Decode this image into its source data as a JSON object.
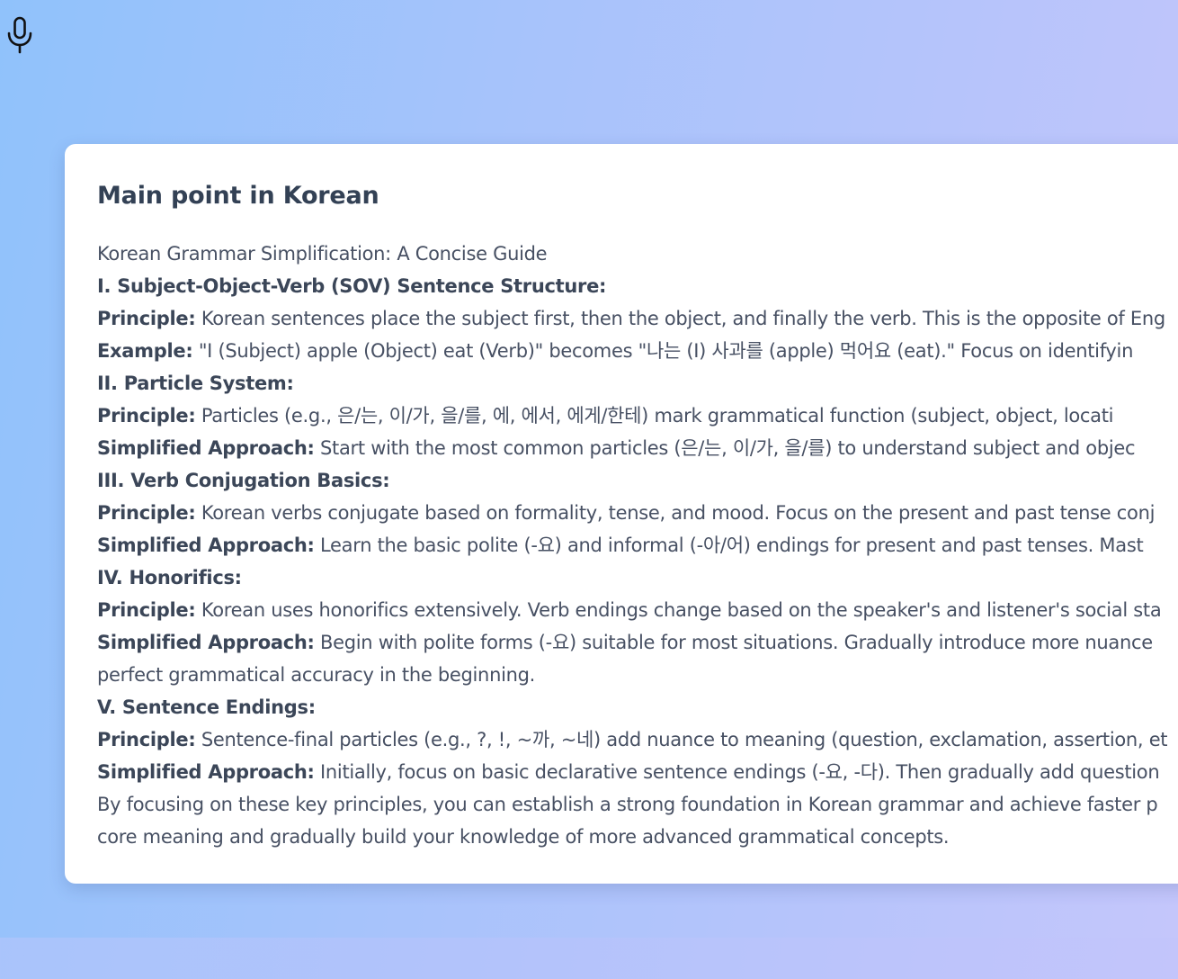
{
  "mic": {
    "icon": "microphone-icon"
  },
  "card": {
    "title": "Main point in Korean",
    "intro": "Korean Grammar Simplification: A Concise Guide",
    "sections": [
      {
        "heading": "I. Subject-Object-Verb (SOV) Sentence Structure:",
        "items": [
          {
            "label": "Principle:",
            "text": "Korean sentences place the subject first, then the object, and finally the verb. This is the opposite of Eng"
          },
          {
            "label": "Example:",
            "text": "\"I (Subject) apple (Object) eat (Verb)\" becomes \"나는 (I) 사과를 (apple) 먹어요 (eat).\" Focus on identifyin"
          }
        ]
      },
      {
        "heading": "II. Particle System:",
        "items": [
          {
            "label": "Principle:",
            "text": "Particles (e.g., 은/는, 이/가, 을/를, 에, 에서, 에게/한테) mark grammatical function (subject, object, locati"
          },
          {
            "label": "Simplified Approach:",
            "text": "Start with the most common particles (은/는, 이/가, 을/를) to understand subject and objec"
          }
        ]
      },
      {
        "heading": "III. Verb Conjugation Basics:",
        "items": [
          {
            "label": "Principle:",
            "text": "Korean verbs conjugate based on formality, tense, and mood. Focus on the present and past tense conj"
          },
          {
            "label": "Simplified Approach:",
            "text": "Learn the basic polite (-요) and informal (-아/어) endings for present and past tenses. Mast"
          }
        ]
      },
      {
        "heading": "IV. Honorifics:",
        "items": [
          {
            "label": "Principle:",
            "text": "Korean uses honorifics extensively. Verb endings change based on the speaker's and listener's social sta"
          },
          {
            "label": "Simplified Approach:",
            "text": "Begin with polite forms (-요) suitable for most situations. Gradually introduce more nuance",
            "continuation": "perfect grammatical accuracy in the beginning."
          }
        ]
      },
      {
        "heading": "V. Sentence Endings:",
        "items": [
          {
            "label": "Principle:",
            "text": "Sentence-final particles (e.g., ?, !, ~까, ~네) add nuance to meaning (question, exclamation, assertion, et"
          },
          {
            "label": "Simplified Approach:",
            "text": "Initially, focus on basic declarative sentence endings (-요, -다). Then gradually add question"
          }
        ]
      }
    ],
    "conclusion": [
      "By focusing on these key principles, you can establish a strong foundation in Korean grammar and achieve faster p",
      "core meaning and gradually build your knowledge of more advanced grammatical concepts."
    ]
  }
}
